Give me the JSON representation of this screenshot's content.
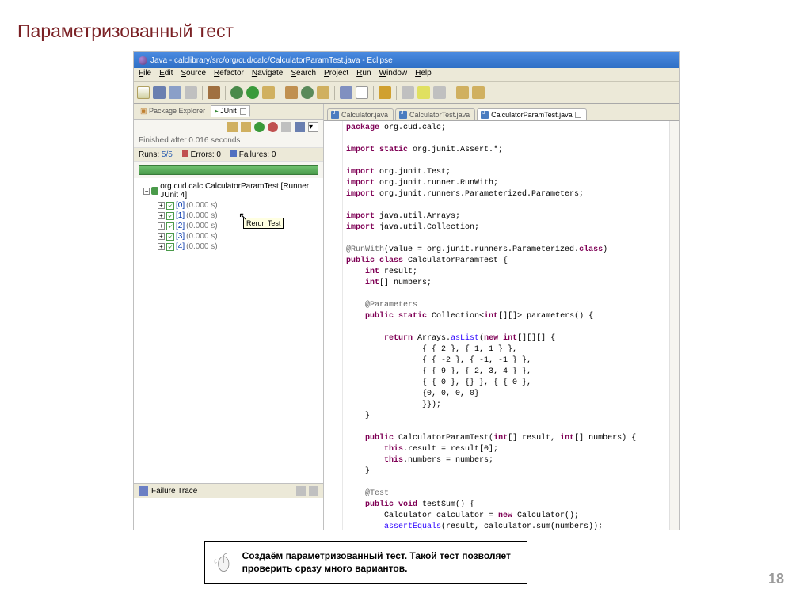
{
  "slide": {
    "title": "Параметризованный тест",
    "page": "18"
  },
  "window": {
    "title": "Java - calclibrary/src/org/cud/calc/CalculatorParamTest.java - Eclipse"
  },
  "menu": [
    "File",
    "Edit",
    "Source",
    "Refactor",
    "Navigate",
    "Search",
    "Project",
    "Run",
    "Window",
    "Help"
  ],
  "junit": {
    "tab_pkg": "Package Explorer",
    "tab_junit": "JUnit",
    "status": "Finished after 0.016 seconds",
    "runs_label": "Runs:",
    "runs_value": "5/5",
    "errors_label": "Errors:",
    "errors_value": "0",
    "failures_label": "Failures:",
    "failures_value": "0",
    "tooltip": "Rerun Test",
    "root": "org.cud.calc.CalculatorParamTest [Runner: JUnit 4]",
    "items": [
      {
        "name": "[0]",
        "time": "(0.000 s)"
      },
      {
        "name": "[1]",
        "time": "(0.000 s)"
      },
      {
        "name": "[2]",
        "time": "(0.000 s)"
      },
      {
        "name": "[3]",
        "time": "(0.000 s)"
      },
      {
        "name": "[4]",
        "time": "(0.000 s)"
      }
    ],
    "failure_trace": "Failure Trace"
  },
  "editor": {
    "tabs": [
      "Calculator.java",
      "CalculatorTest.java",
      "CalculatorParamTest.java"
    ],
    "code": [
      {
        "t": [
          {
            "c": "kw",
            "s": "package"
          },
          {
            "s": " org.cud.calc;"
          }
        ]
      },
      {
        "t": []
      },
      {
        "m": "+",
        "t": [
          {
            "c": "kw",
            "s": "import static"
          },
          {
            "s": " org.junit.Assert.*;"
          }
        ]
      },
      {
        "t": []
      },
      {
        "t": [
          {
            "c": "kw",
            "s": "import"
          },
          {
            "s": " org.junit.Test;"
          }
        ]
      },
      {
        "t": [
          {
            "c": "kw",
            "s": "import"
          },
          {
            "s": " org.junit.runner.RunWith;"
          }
        ]
      },
      {
        "t": [
          {
            "c": "kw",
            "s": "import"
          },
          {
            "s": " org.junit.runners.Parameterized.Parameters;"
          }
        ]
      },
      {
        "t": []
      },
      {
        "t": [
          {
            "c": "kw",
            "s": "import"
          },
          {
            "s": " java.util.Arrays;"
          }
        ]
      },
      {
        "t": [
          {
            "c": "kw",
            "s": "import"
          },
          {
            "s": " java.util.Collection;"
          }
        ]
      },
      {
        "t": []
      },
      {
        "t": [
          {
            "c": "an",
            "s": "@RunWith"
          },
          {
            "s": "(value = org.junit.runners.Parameterized."
          },
          {
            "c": "kw",
            "s": "class"
          },
          {
            "s": ")"
          }
        ]
      },
      {
        "t": [
          {
            "c": "kw",
            "s": "public class"
          },
          {
            "s": " CalculatorParamTest {"
          }
        ]
      },
      {
        "t": [
          {
            "s": "    "
          },
          {
            "c": "kw",
            "s": "int"
          },
          {
            "s": " result;"
          }
        ]
      },
      {
        "t": [
          {
            "s": "    "
          },
          {
            "c": "kw",
            "s": "int"
          },
          {
            "s": "[] numbers;"
          }
        ]
      },
      {
        "t": []
      },
      {
        "m": "−",
        "t": [
          {
            "s": "    "
          },
          {
            "c": "an",
            "s": "@Parameters"
          }
        ]
      },
      {
        "t": [
          {
            "s": "    "
          },
          {
            "c": "kw",
            "s": "public static"
          },
          {
            "s": " Collection<"
          },
          {
            "c": "kw",
            "s": "int"
          },
          {
            "s": "[][]> parameters() {"
          }
        ]
      },
      {
        "t": []
      },
      {
        "t": [
          {
            "s": "        "
          },
          {
            "c": "kw",
            "s": "return"
          },
          {
            "s": " Arrays."
          },
          {
            "c": "st",
            "s": "asList"
          },
          {
            "s": "("
          },
          {
            "c": "kw",
            "s": "new int"
          },
          {
            "s": "[][][] {"
          }
        ]
      },
      {
        "t": [
          {
            "s": "                { { 2 }, { 1, 1 } },"
          }
        ]
      },
      {
        "t": [
          {
            "s": "                { { -2 }, { -1, -1 } },"
          }
        ]
      },
      {
        "t": [
          {
            "s": "                { { 9 }, { 2, 3, 4 } },"
          }
        ]
      },
      {
        "t": [
          {
            "s": "                { { 0 }, {} }, { { 0 },"
          }
        ]
      },
      {
        "t": [
          {
            "s": "                {0, 0, 0, 0}"
          }
        ]
      },
      {
        "t": [
          {
            "s": "                }});"
          }
        ]
      },
      {
        "t": [
          {
            "s": "    }"
          }
        ]
      },
      {
        "t": []
      },
      {
        "m": "−",
        "t": [
          {
            "s": "    "
          },
          {
            "c": "kw",
            "s": "public"
          },
          {
            "s": " CalculatorParamTest("
          },
          {
            "c": "kw",
            "s": "int"
          },
          {
            "s": "[] result, "
          },
          {
            "c": "kw",
            "s": "int"
          },
          {
            "s": "[] numbers) {"
          }
        ]
      },
      {
        "t": [
          {
            "s": "        "
          },
          {
            "c": "kw",
            "s": "this"
          },
          {
            "s": ".result = result[0];"
          }
        ]
      },
      {
        "t": [
          {
            "s": "        "
          },
          {
            "c": "kw",
            "s": "this"
          },
          {
            "s": ".numbers = numbers;"
          }
        ]
      },
      {
        "t": [
          {
            "s": "    }"
          }
        ]
      },
      {
        "t": []
      },
      {
        "m": "−",
        "t": [
          {
            "s": "    "
          },
          {
            "c": "an",
            "s": "@Test"
          }
        ]
      },
      {
        "t": [
          {
            "s": "    "
          },
          {
            "c": "kw",
            "s": "public void"
          },
          {
            "s": " testSum() {"
          }
        ]
      },
      {
        "t": [
          {
            "s": "        Calculator calculator = "
          },
          {
            "c": "kw",
            "s": "new"
          },
          {
            "s": " Calculator();"
          }
        ]
      },
      {
        "t": [
          {
            "s": "        "
          },
          {
            "c": "st",
            "s": "assertEquals"
          },
          {
            "s": "(result, calculator.sum(numbers));"
          }
        ]
      },
      {
        "t": [
          {
            "s": "    }"
          }
        ]
      },
      {
        "t": [
          {
            "s": "}"
          }
        ]
      }
    ]
  },
  "footnote": "Создаём параметризованный тест. Такой тест позволяет проверить сразу много вариантов."
}
